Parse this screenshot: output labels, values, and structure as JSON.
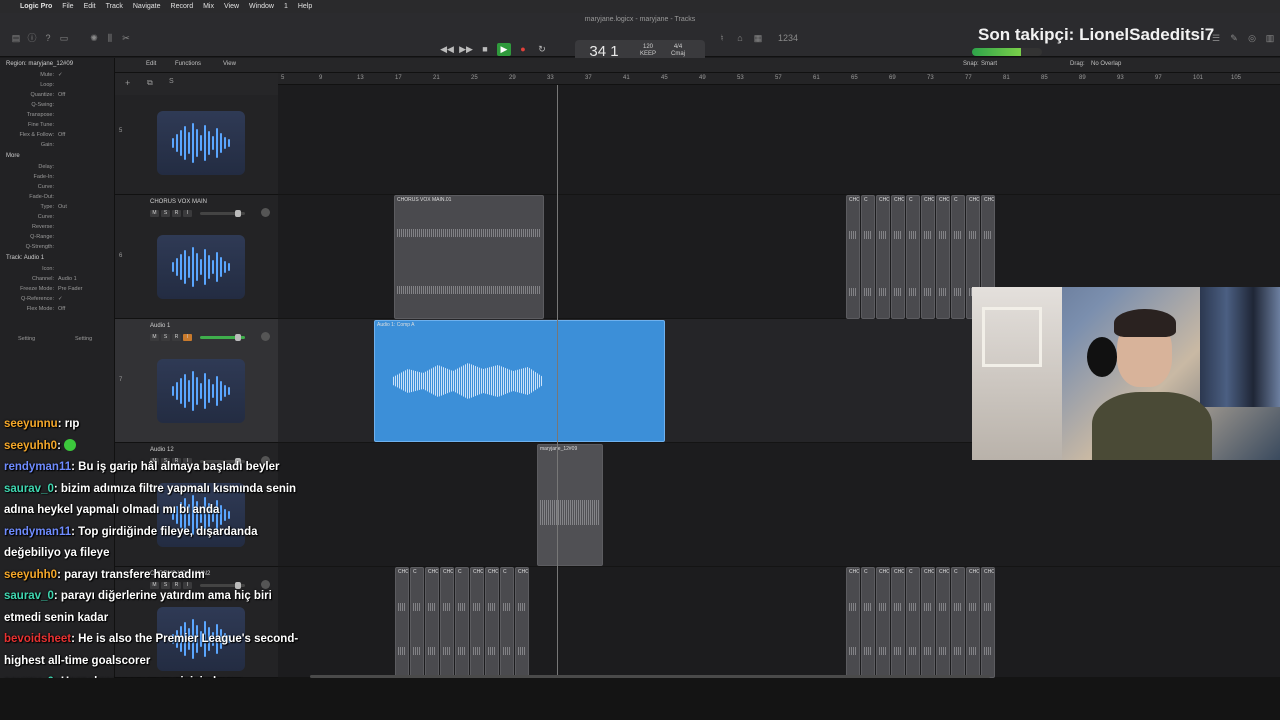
{
  "menubar": {
    "apple": "",
    "app": "Logic Pro",
    "items": [
      "File",
      "Edit",
      "Track",
      "Navigate",
      "Record",
      "Mix",
      "View",
      "Window",
      "1",
      "Help"
    ]
  },
  "window": {
    "title": "maryjane.logicx - maryjane - Tracks"
  },
  "lcd": {
    "position": "34 1",
    "tempo": "120",
    "tempo_label": "KEEP",
    "signature": "4/4",
    "key": "Cmaj"
  },
  "overlay": {
    "follower": "Son takipçi: LionelSadeditsi7"
  },
  "inspector": {
    "region_label": "Region: maryjane_12#09",
    "rows": [
      {
        "label": "Mute:",
        "value": "✓"
      },
      {
        "label": "Loop:",
        "value": ""
      },
      {
        "label": "Quantize:",
        "value": "Off"
      },
      {
        "label": "Q-Swing:",
        "value": ""
      },
      {
        "label": "Transpose:",
        "value": ""
      },
      {
        "label": "Fine Tune:",
        "value": ""
      },
      {
        "label": "Flex & Follow:",
        "value": "Off"
      },
      {
        "label": "Gain:",
        "value": ""
      }
    ],
    "more_label": "More",
    "rows2": [
      {
        "label": "Delay:",
        "value": ""
      },
      {
        "label": "Fade-In:",
        "value": ""
      },
      {
        "label": "Curve:",
        "value": ""
      },
      {
        "label": "Fade-Out:",
        "value": ""
      },
      {
        "label": "Type:",
        "value": "Out"
      },
      {
        "label": "Curve:",
        "value": ""
      },
      {
        "label": "Reverse:",
        "value": ""
      },
      {
        "label": "Q-Range:",
        "value": ""
      },
      {
        "label": "Q-Strength:",
        "value": ""
      }
    ],
    "track_label": "Track: Audio 1",
    "rows3": [
      {
        "label": "Icon:",
        "value": ""
      },
      {
        "label": "Channel:",
        "value": "Audio 1"
      },
      {
        "label": "Freeze Mode:",
        "value": "Pre Fader"
      },
      {
        "label": "Q-Reference:",
        "value": "✓"
      },
      {
        "label": "Flex Mode:",
        "value": "Off"
      }
    ],
    "setting_labels": [
      "Setting",
      "Setting"
    ]
  },
  "tracks_toolbar": {
    "edit": "Edit",
    "functions": "Functions",
    "view": "View",
    "snap_label": "Snap:",
    "snap_value": "Smart",
    "drag_label": "Drag:",
    "drag_value": "No Overlap"
  },
  "ruler": [
    "5",
    "9",
    "13",
    "17",
    "21",
    "25",
    "29",
    "33",
    "37",
    "41",
    "45",
    "49",
    "53",
    "57",
    "61",
    "65",
    "69",
    "73",
    "77",
    "81",
    "85",
    "89",
    "93",
    "97",
    "101",
    "105"
  ],
  "tracks": [
    {
      "num": "5",
      "name": ""
    },
    {
      "num": "6",
      "name": "CHORUS VOX MAIN"
    },
    {
      "num": "7",
      "name": "Audio 1"
    },
    {
      "num": "",
      "name": "Audio 12"
    },
    {
      "num": "",
      "name": "CHORUS VOX MAIN2"
    }
  ],
  "regions": {
    "chorus_main": "CHORUS VOX MAIN.01",
    "comp": "Audio 1: Comp A",
    "maryjane": "maryjane_12#09",
    "cho_tag": "CHO",
    "c_tag": "C"
  },
  "chat": [
    {
      "user": "seeyunnu",
      "color": "orange",
      "text": ": rıp"
    },
    {
      "user": "seeyuhh0",
      "color": "orange",
      "text": ": ",
      "emote": true
    },
    {
      "user": "rendyman11",
      "color": "blue",
      "text": ": Bu iş garip hâl almaya başladı beyler"
    },
    {
      "user": "saurav_0",
      "color": "teal",
      "text": ": bizim adımıza filtre yapmalı kısmında senin adına heykel yapmalı olmadı mı bı anda"
    },
    {
      "user": "rendyman11",
      "color": "blue",
      "text": ": Top girdiğinde fileye, dışardanda değebiliyo ya fileye"
    },
    {
      "user": "seeyuhh0",
      "color": "orange",
      "text": ": parayı transfere harcadım"
    },
    {
      "user": "saurav_0",
      "color": "teal",
      "text": ": parayı diğerlerine yatırdım ama hiç biri etmedi senin kadar"
    },
    {
      "user": "bevoidsheet",
      "color": "red",
      "text": ": He is also the Premier League's second-highest all-time goalscorer"
    },
    {
      "user": "saurav_0",
      "color": "teal",
      "text": ": Harry kramponunun çivisi olayım"
    }
  ],
  "colors": {
    "region_blue": "#3c8fd8",
    "play_green": "#2f9a3c",
    "record_red": "#e2403a"
  }
}
